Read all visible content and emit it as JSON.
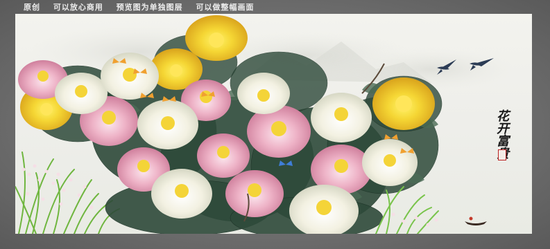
{
  "banner": {
    "items": [
      "原创",
      "可以放心商用",
      "预览图为单独图层",
      "可以做整幅画面"
    ]
  },
  "calligraphy": {
    "text": "花开富贵"
  },
  "colors": {
    "frame": "#6e6e6e",
    "paper": "#f0f0ec",
    "peony_yellow": "#f2d13a",
    "peony_pink": "#e9a8bf",
    "peony_white": "#f5f3e6",
    "leaf": "#2d4a37",
    "grass": "#7cc04a"
  },
  "elements": {
    "peonies": "multiple peony blossoms in yellow, pink and white",
    "butterflies": "small orange and blue butterflies",
    "birds": "two swallows in flight",
    "boat": "small boat at lower right"
  }
}
